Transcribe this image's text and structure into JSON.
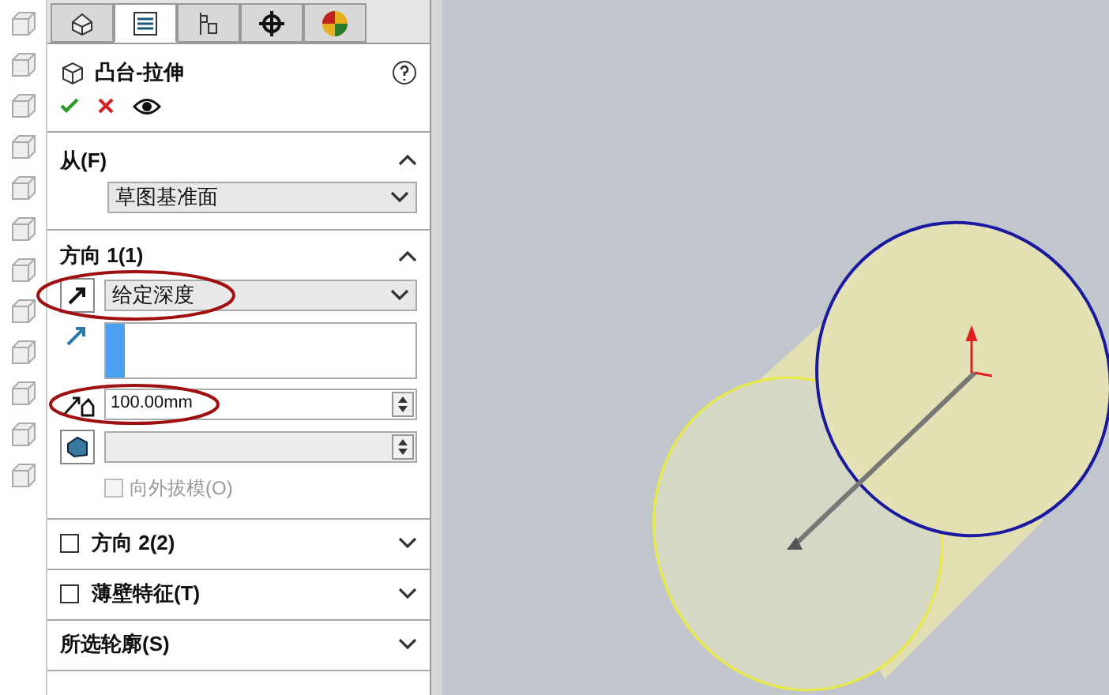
{
  "tabs": [
    {
      "kind": "feature",
      "selected": false
    },
    {
      "kind": "property",
      "selected": true
    },
    {
      "kind": "config",
      "selected": false
    },
    {
      "kind": "dimxpert",
      "selected": false
    },
    {
      "kind": "display",
      "selected": false
    }
  ],
  "feature": {
    "title": "凸台-拉伸"
  },
  "from": {
    "label": "从(F)",
    "expanded": true,
    "value": "草图基准面"
  },
  "direction1": {
    "label": "方向 1(1)",
    "expanded": true,
    "end_condition": "给定深度",
    "depth": "100.00mm",
    "draft_label": "向外拔模(O)",
    "draft_checked": false,
    "draft_disabled": true
  },
  "collapsed_sections": [
    {
      "kind": "checkbox",
      "label": "方向 2(2)",
      "checked": false,
      "expanded": false
    },
    {
      "kind": "checkbox",
      "label": "薄壁特征(T)",
      "checked": false,
      "expanded": false
    },
    {
      "kind": "plain",
      "label": "所选轮廓(S)",
      "expanded": false
    }
  ]
}
